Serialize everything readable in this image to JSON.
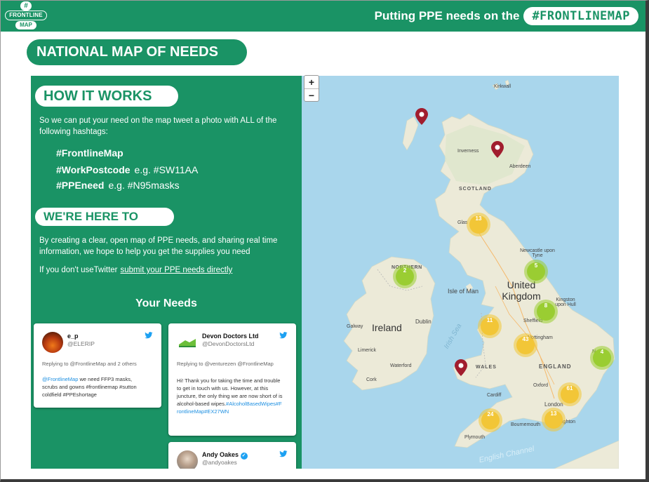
{
  "header": {
    "logo": {
      "hash": "#",
      "word": "FRONTLINE",
      "map": "MAP"
    },
    "tagline": "Putting PPE needs on the",
    "tagline_pill": "#FRONTLINEMAP"
  },
  "page_title": "NATIONAL MAP OF NEEDS",
  "how_it_works": {
    "title": "HOW IT WORKS",
    "text": "So we can put your need on the map tweet a photo with ALL of the following hashtags:",
    "tags": [
      {
        "tag": "#FrontlineMap",
        "example": ""
      },
      {
        "tag": "#WorkPostcode",
        "example": "e.g.  #SW11AA"
      },
      {
        "tag": "#PPEneed",
        "example": "e.g. #N95masks"
      }
    ]
  },
  "help": {
    "title": "WE'RE HERE TO HELP",
    "text": "By creating a clear, open map of PPE needs, and sharing real time information, we hope to help you get the supplies you need",
    "twitter_text": "If you don't useTwitter",
    "twitter_link": "submit your PPE needs directly"
  },
  "your_needs_title": "Your Needs",
  "tweets": [
    {
      "name": "e_p",
      "handle": "@ELERIP",
      "reply": "Replying to @FrontlineMap and 2 others",
      "body_highlight": "@FrontlineMap",
      "body": " we need FFP3 masks, scrubs and gowns #frontlinemap #sutton coldfield #PPEshortage"
    },
    {
      "name": "Devon Doctors Ltd",
      "handle": "@DevonDoctorsLtd",
      "reply": "Replying to @venturezen @FrontlineMap",
      "body": "Hi! Thank you for taking the time and trouble to get in touch with us. However, at this juncture, the only thing we are now short of is alcohol-based wipes.",
      "body_highlight": "#AlcoholBasedWipes#FrontlineMap#EX27WN"
    },
    {
      "name": "Andy Oakes",
      "handle": "@andyoakes"
    }
  ],
  "map": {
    "zoom_in": "+",
    "zoom_out": "−",
    "labels": {
      "kirkwall": "Kirkwall",
      "inverness": "Inverness",
      "aberdeen": "Aberdeen",
      "scotland": "SCOTLAND",
      "glasgow": "Glas",
      "newcastle": "Newcastle upon Tyne",
      "northern": "NORTHERN",
      "isle_of_man": "Isle of Man",
      "uk": "United Kingdom",
      "kingston": "Kingston upon Hull",
      "ireland": "Ireland",
      "galway": "Galway",
      "dublin": "Dublin",
      "irish_sea": "Irish Sea",
      "sheffield": "Sheffield",
      "nottingham": "Nottingham",
      "limerick": "Limerick",
      "waterford": "Waterford",
      "cork": "Cork",
      "wales": "WALES",
      "england": "ENGLAND",
      "norwich": "N",
      "oxford": "Oxford",
      "cardiff": "Cardiff",
      "london": "London",
      "bournemouth": "Bournemouth",
      "brighton": "Brighton",
      "plymouth": "Plymouth",
      "english_channel": "English Channel"
    },
    "clusters": [
      {
        "id": "glasgow",
        "count": "13",
        "color": "yellow"
      },
      {
        "id": "newcastle",
        "count": "5",
        "color": "green"
      },
      {
        "id": "belfast",
        "count": "2",
        "color": "green"
      },
      {
        "id": "leeds",
        "count": "8",
        "color": "green"
      },
      {
        "id": "liverpool",
        "count": "11",
        "color": "yellow"
      },
      {
        "id": "birmingham",
        "count": "43",
        "color": "yellow"
      },
      {
        "id": "norwich",
        "count": "4",
        "color": "green"
      },
      {
        "id": "london",
        "count": "61",
        "color": "yellow"
      },
      {
        "id": "exeter",
        "count": "24",
        "color": "yellow"
      },
      {
        "id": "southampton",
        "count": "13",
        "color": "yellow"
      }
    ],
    "colors": {
      "sea": "#a9d6ec",
      "land": "#ecead8",
      "cluster_yellow": "#f2c637",
      "cluster_green": "#9acd32",
      "pin": "#a11d2e"
    }
  },
  "colors": {
    "brand_green": "#1a9365",
    "tweet_link": "#1d8fe1",
    "twitter_blue": "#1da1f2"
  }
}
